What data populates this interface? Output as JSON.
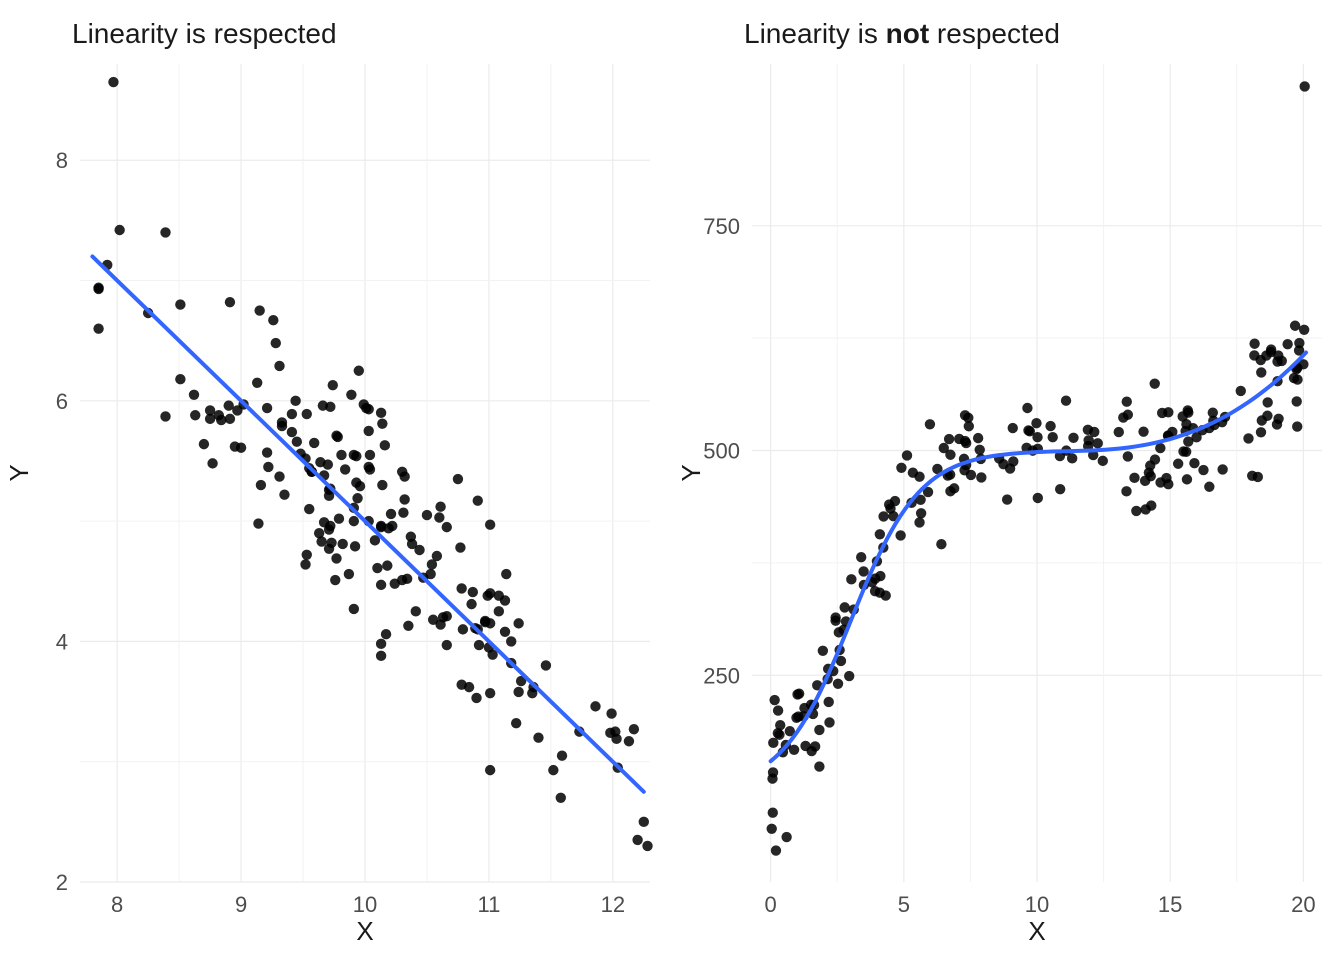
{
  "chart_data": [
    {
      "type": "scatter",
      "title": "Linearity is respected",
      "xlabel": "X",
      "ylabel": "Y",
      "xlim": [
        7.7,
        12.3
      ],
      "ylim": [
        2,
        8.8
      ],
      "xticks": [
        8,
        9,
        10,
        11,
        12
      ],
      "yticks": [
        2,
        4,
        6,
        8
      ],
      "grid": true,
      "fit": {
        "kind": "line",
        "slope": -1.0,
        "intercept": 15.0,
        "x0": 7.8,
        "x1": 12.25
      },
      "series": [
        {
          "name": "points",
          "x": [],
          "y": []
        }
      ]
    },
    {
      "type": "scatter",
      "title_html": "Linearity is <b>not</b> respected",
      "xlabel": "X",
      "ylabel": "Y",
      "xlim": [
        -0.7,
        20.7
      ],
      "ylim": [
        20,
        930
      ],
      "xticks": [
        0,
        5,
        10,
        15,
        20
      ],
      "yticks": [
        250,
        500,
        750
      ],
      "grid": true,
      "fit": {
        "kind": "cubic",
        "x0": 0.0,
        "x1": 20.1
      },
      "series": [
        {
          "name": "points",
          "x": [],
          "y": []
        }
      ]
    }
  ],
  "labels": {
    "left_title": "Linearity is respected",
    "right_title_prefix": "Linearity is ",
    "right_title_emph": "not",
    "right_title_suffix": " respected",
    "xlabel": "X",
    "ylabel": "Y"
  }
}
